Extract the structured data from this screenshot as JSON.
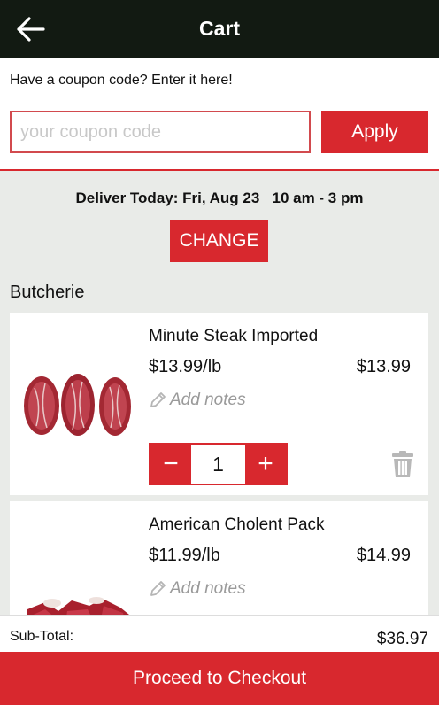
{
  "header": {
    "title": "Cart",
    "back_icon": "arrow-left-icon"
  },
  "coupon": {
    "prompt": "Have a coupon code? Enter it here!",
    "placeholder": "your coupon code",
    "value": "",
    "apply_label": "Apply"
  },
  "delivery": {
    "text": "Deliver Today: Fri, Aug 23   10 am - 3 pm",
    "change_label": "CHANGE"
  },
  "section": {
    "title": "Butcherie"
  },
  "items": [
    {
      "name": "Minute Steak Imported",
      "unit_price": "$13.99/lb",
      "total": "$13.99",
      "notes_label": "Add notes",
      "quantity": "1",
      "minus": "−",
      "plus": "+"
    },
    {
      "name": "American Cholent Pack",
      "unit_price": "$11.99/lb",
      "total": "$14.99",
      "notes_label": "Add notes"
    }
  ],
  "summary": {
    "subtotal_label": "Sub-Total:",
    "subtotal_value": "$36.97"
  },
  "checkout": {
    "label": "Proceed to Checkout"
  },
  "colors": {
    "accent": "#d8282e",
    "header_bg": "#121a12",
    "page_bg": "#e9ebe8"
  }
}
